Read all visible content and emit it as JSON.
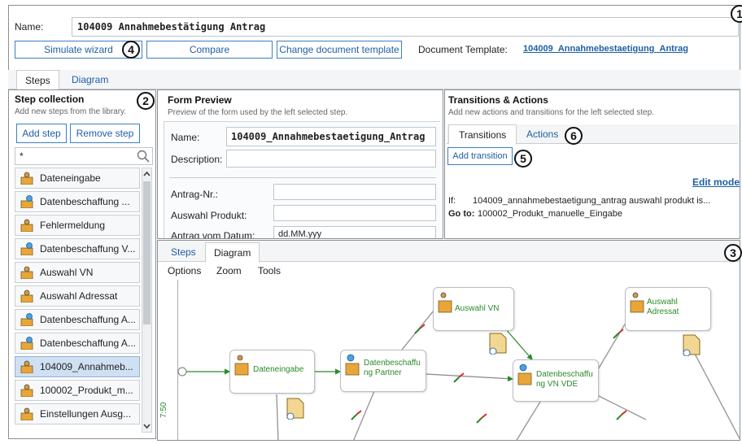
{
  "header": {
    "name_label": "Name:",
    "name_value": "104009 Annahmebestätigung Antrag",
    "simulate_label": "Simulate wizard",
    "compare_label": "Compare",
    "change_template_label": "Change document template",
    "doc_template_label": "Document Template:",
    "doc_template_link": "104009_Annahmebestaetigung_Antrag"
  },
  "callouts": [
    "1",
    "2",
    "3",
    "4",
    "5",
    "6"
  ],
  "main_tabs": [
    {
      "label": "Steps"
    },
    {
      "label": "Diagram"
    }
  ],
  "step_collection": {
    "title": "Step collection",
    "hint": "Add new steps from the library.",
    "add_label": "Add step",
    "remove_label": "Remove step",
    "filter_value": "*",
    "items": [
      {
        "label": "Dateneingabe",
        "icon": "user-form-icon"
      },
      {
        "label": "Datenbeschaffung ...",
        "icon": "service-form-icon"
      },
      {
        "label": "Fehlermeldung",
        "icon": "user-form-icon"
      },
      {
        "label": "Datenbeschaffung V...",
        "icon": "service-form-icon"
      },
      {
        "label": "Auswahl VN",
        "icon": "user-form-icon"
      },
      {
        "label": "Auswahl Adressat",
        "icon": "user-form-icon"
      },
      {
        "label": "Datenbeschaffung A...",
        "icon": "service-form-icon"
      },
      {
        "label": "Datenbeschaffung A...",
        "icon": "service-form-icon"
      },
      {
        "label": "104009_Annahmeb...",
        "icon": "user-form-icon"
      },
      {
        "label": "100002_Produkt_m...",
        "icon": "user-form-icon"
      },
      {
        "label": "Einstellungen Ausg...",
        "icon": "user-form-icon"
      }
    ],
    "selected_index": 8
  },
  "form_preview": {
    "title": "Form Preview",
    "hint": "Preview of the form used by the left selected step.",
    "name_label": "Name:",
    "name_value": "104009_Annahmebestaetigung_Antrag",
    "desc_label": "Description:",
    "fields": [
      {
        "label": "Antrag-Nr.:",
        "value": ""
      },
      {
        "label": "Auswahl Produkt:",
        "value": ""
      },
      {
        "label": "Antrag vom Datum:",
        "value": "dd.MM.yyy"
      }
    ]
  },
  "transitions": {
    "title": "Transitions & Actions",
    "hint": "Add new actions and transitions for the left selected step.",
    "tabs": [
      {
        "label": "Transitions"
      },
      {
        "label": "Actions"
      }
    ],
    "add_label": "Add transition",
    "edit_mode_label": "Edit mode",
    "if_label": "If:",
    "if_value": "104009_annahmebestaetigung_antrag auswahl produkt is...",
    "goto_label": "Go to:",
    "goto_value": "100002_Produkt_manuelle_Eingabe"
  },
  "diagram": {
    "tabs": [
      {
        "label": "Steps"
      },
      {
        "label": "Diagram"
      }
    ],
    "menu": [
      "Options",
      "Zoom",
      "Tools"
    ],
    "ruler_label": "7:50",
    "nodes": [
      {
        "label": "Dateneingabe"
      },
      {
        "label": "Datenbeschaffu ng Partner"
      },
      {
        "label": "Auswahl VN"
      },
      {
        "label": "Datenbeschaffu ng VN VDE"
      },
      {
        "label": "Auswahl Adressat"
      }
    ]
  },
  "colors": {
    "accent": "#1f5fa6",
    "node_text": "#2a8a2a",
    "border": "#3b7fc4"
  }
}
